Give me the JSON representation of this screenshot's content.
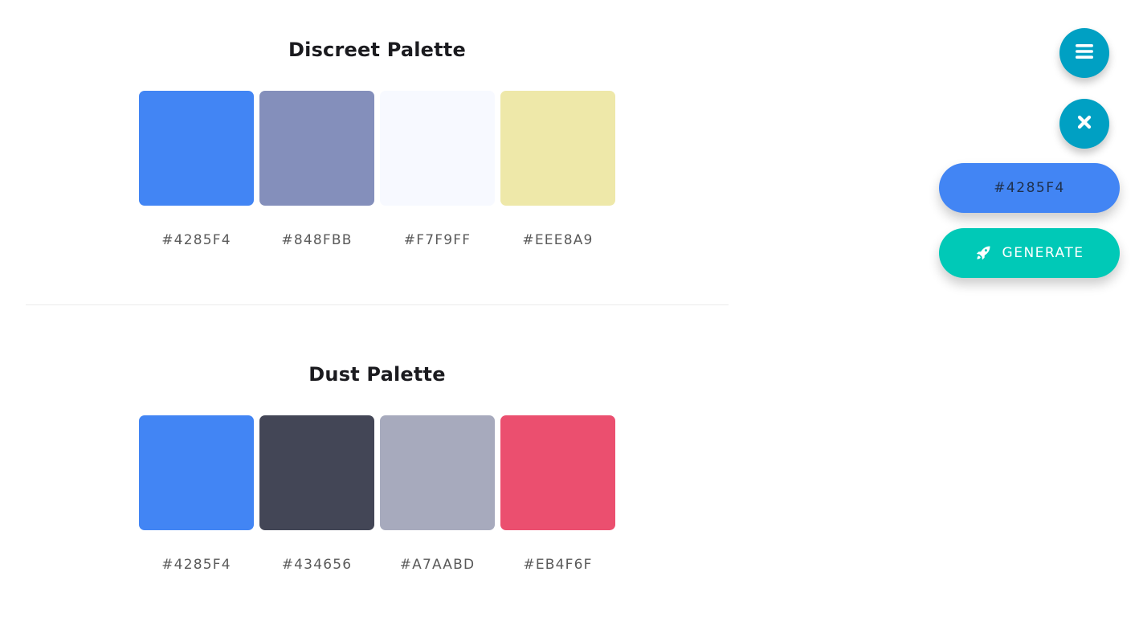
{
  "palettes": [
    {
      "title": "Discreet Palette",
      "swatches": [
        {
          "hex": "#4285F4",
          "color": "#4285F4"
        },
        {
          "hex": "#848FBB",
          "color": "#848FBB"
        },
        {
          "hex": "#F7F9FF",
          "color": "#F7F9FF"
        },
        {
          "hex": "#EEE8A9",
          "color": "#EEE8A9"
        }
      ]
    },
    {
      "title": "Dust Palette",
      "swatches": [
        {
          "hex": "#4285F4",
          "color": "#4285F4"
        },
        {
          "hex": "#434656",
          "color": "#434656"
        },
        {
          "hex": "#A7AABD",
          "color": "#A7AABD"
        },
        {
          "hex": "#EB4F6F",
          "color": "#EB4F6F"
        }
      ]
    }
  ],
  "actions": {
    "menu_icon": "menu-icon",
    "close_icon": "close-icon",
    "current_color": "#4285F4",
    "generate_label": "GENERATE",
    "generate_icon": "rocket-icon"
  },
  "colors": {
    "fab": "#00A0C3",
    "current_pill": "#4285F4",
    "generate_pill": "#00C9B7"
  }
}
